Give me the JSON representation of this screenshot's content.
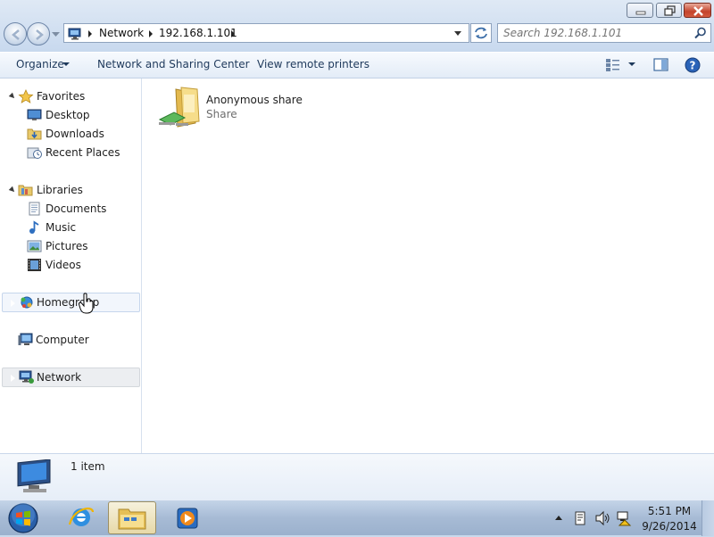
{
  "window": {
    "caption_buttons": [
      "minimize",
      "maximize",
      "close"
    ]
  },
  "address": {
    "icon": "network-icon",
    "crumbs": [
      "Network",
      "192.168.1.101"
    ]
  },
  "search": {
    "placeholder": "Search 192.168.1.101"
  },
  "toolbar": {
    "organize": "Organize",
    "network_sharing": "Network and Sharing Center",
    "view_printers": "View remote printers",
    "icons": [
      "change-view-icon",
      "preview-pane-icon",
      "help-icon"
    ]
  },
  "navpane": {
    "favorites": {
      "label": "Favorites",
      "items": [
        "Desktop",
        "Downloads",
        "Recent Places"
      ]
    },
    "libraries": {
      "label": "Libraries",
      "items": [
        "Documents",
        "Music",
        "Pictures",
        "Videos"
      ]
    },
    "homegroup": "Homegroup",
    "computer": "Computer",
    "network": "Network"
  },
  "content": {
    "items": [
      {
        "name": "Anonymous share",
        "type": "Share",
        "icon": "shared-folder-icon"
      }
    ]
  },
  "details": {
    "count": "1 item",
    "icon": "computer-icon"
  },
  "taskbar": {
    "apps": [
      "start-orb",
      "internet-explorer-icon",
      "windows-explorer-icon",
      "media-player-icon"
    ],
    "time": "5:51 PM",
    "date": "9/26/2014"
  },
  "colors": {
    "accent": "#1e395b",
    "selection": "#c6d6ec",
    "close_button": "#c4432c"
  }
}
